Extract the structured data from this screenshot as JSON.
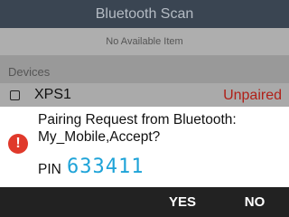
{
  "screen": {
    "title": "Bluetooth Scan",
    "no_items_text": "No Available Item",
    "devices_header": "Devices",
    "devices": [
      {
        "name": "XPS1",
        "status": "Unpaired",
        "checked": false
      }
    ]
  },
  "dialog": {
    "message": "Pairing Request from Bluetooth: My_Mobile,Accept?",
    "pin_label": "PIN",
    "pin_value": "633411",
    "icon": "alert-icon",
    "icon_glyph": "!",
    "yes_label": "YES",
    "no_label": "NO"
  },
  "colors": {
    "title_bar": "#3a4552",
    "pin": "#1ea3d8",
    "unpaired": "#b02018",
    "alert": "#e0392b",
    "action_bar": "#222222"
  }
}
